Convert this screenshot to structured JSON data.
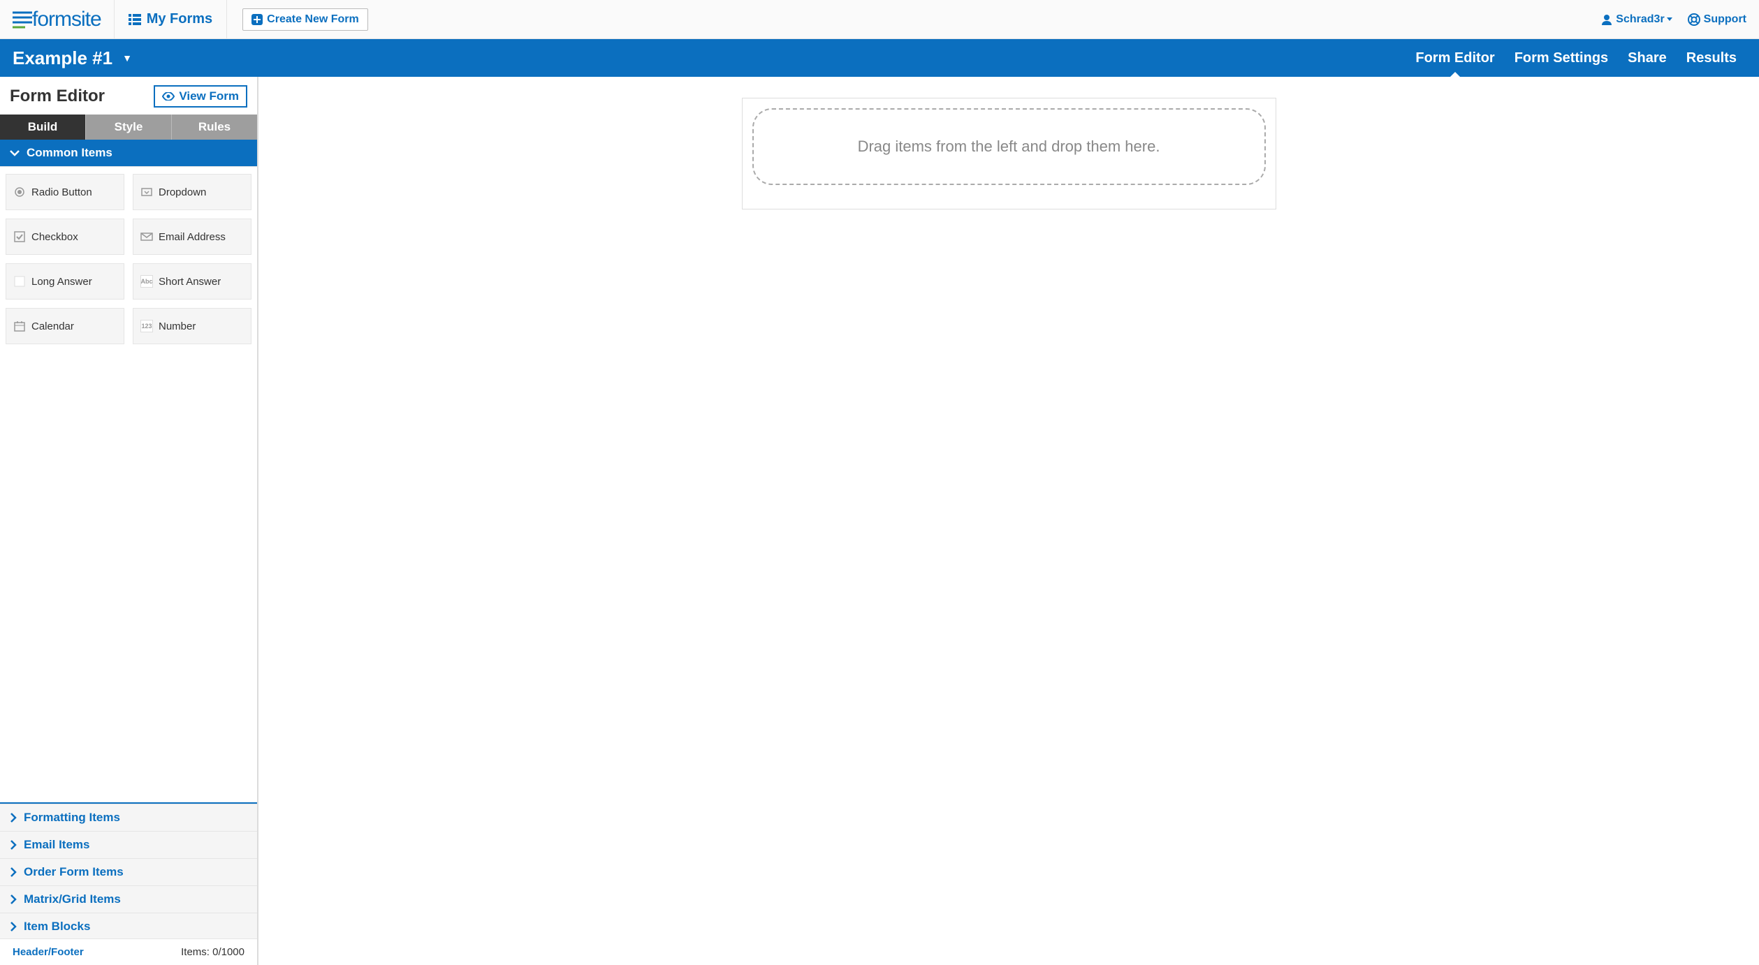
{
  "header": {
    "logo_text": "formsite",
    "my_forms": "My Forms",
    "create_new_form": "Create New Form",
    "user_name": "Schrad3r",
    "support": "Support"
  },
  "form_nav": {
    "form_name": "Example #1",
    "tabs": [
      {
        "label": "Form Editor",
        "active": true
      },
      {
        "label": "Form Settings",
        "active": false
      },
      {
        "label": "Share",
        "active": false
      },
      {
        "label": "Results",
        "active": false
      }
    ]
  },
  "sidebar": {
    "title": "Form Editor",
    "view_form": "View Form",
    "editor_tabs": [
      {
        "label": "Build",
        "active": true
      },
      {
        "label": "Style",
        "active": false
      },
      {
        "label": "Rules",
        "active": false
      }
    ],
    "common_items_header": "Common Items",
    "items": [
      {
        "label": "Radio Button",
        "icon": "radio"
      },
      {
        "label": "Dropdown",
        "icon": "dropdown"
      },
      {
        "label": "Checkbox",
        "icon": "checkbox"
      },
      {
        "label": "Email Address",
        "icon": "email"
      },
      {
        "label": "Long Answer",
        "icon": "long"
      },
      {
        "label": "Short Answer",
        "icon": "abc"
      },
      {
        "label": "Calendar",
        "icon": "calendar"
      },
      {
        "label": "Number",
        "icon": "123"
      }
    ],
    "collapsed_categories": [
      "Formatting Items",
      "Email Items",
      "Order Form Items",
      "Matrix/Grid Items",
      "Item Blocks"
    ],
    "footer": {
      "header_footer": "Header/Footer",
      "items_count": "Items: 0/1000"
    }
  },
  "canvas": {
    "drop_hint": "Drag items from the left and drop them here."
  }
}
